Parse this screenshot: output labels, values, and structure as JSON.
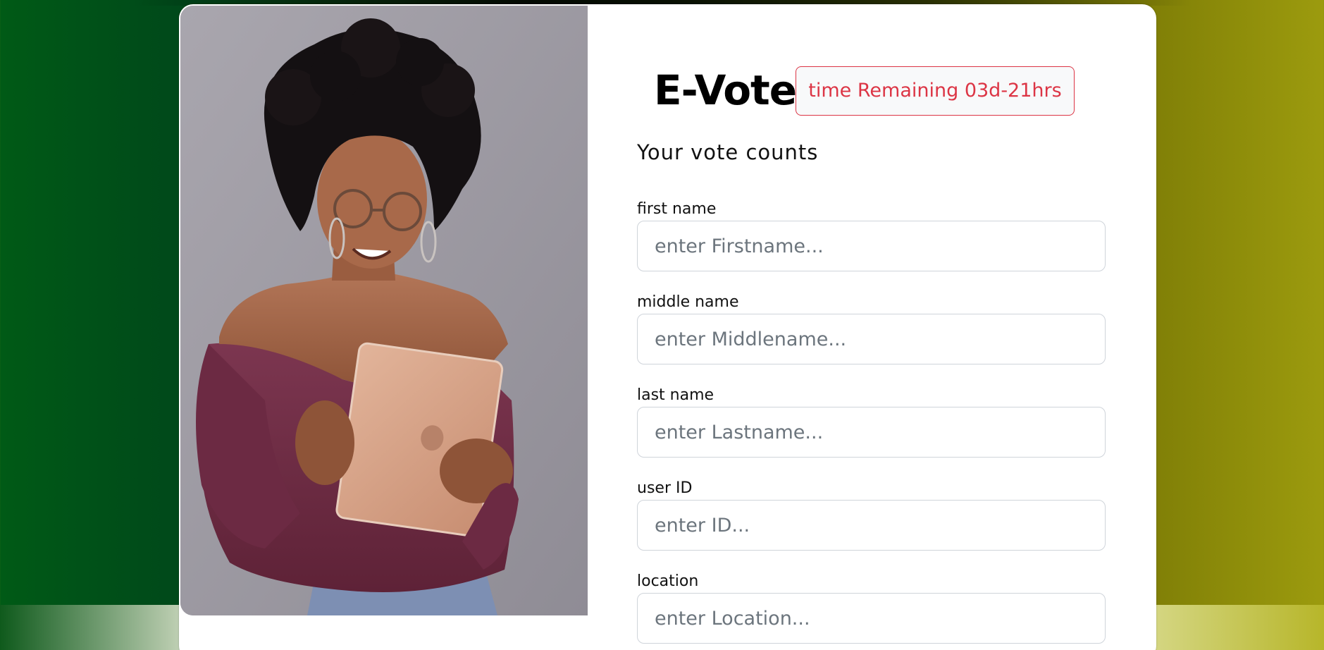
{
  "app": {
    "title": "E-Vote",
    "timer": "time Remaining 03d-21hrs",
    "tagline": "Your vote counts"
  },
  "hero_image": {
    "description_icon": "woman-with-tablet-photo"
  },
  "form": {
    "fields": [
      {
        "label": "first name",
        "placeholder": "enter Firstname...",
        "value": ""
      },
      {
        "label": "middle name",
        "placeholder": "enter Middlename...",
        "value": ""
      },
      {
        "label": "last name",
        "placeholder": "enter Lastname...",
        "value": ""
      },
      {
        "label": "user ID",
        "placeholder": "enter ID...",
        "value": ""
      },
      {
        "label": "location",
        "placeholder": "enter Location...",
        "value": ""
      }
    ]
  },
  "colors": {
    "accent_danger": "#dc3545",
    "background_left": "#005a16",
    "background_right": "#9c9b0e"
  }
}
